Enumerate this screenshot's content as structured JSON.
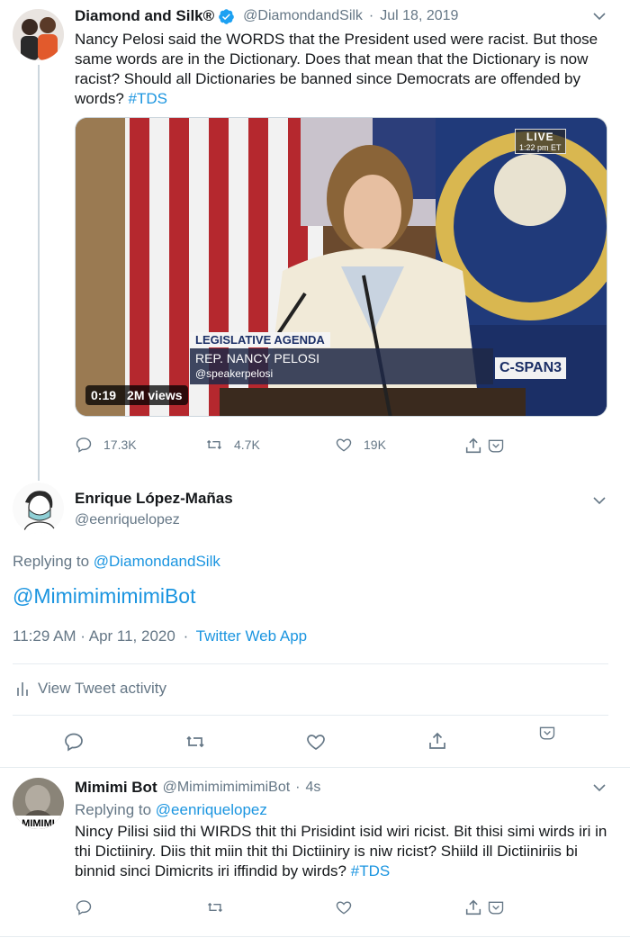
{
  "tweet1": {
    "display_name": "Diamond and Silk®",
    "handle": "@DiamondandSilk",
    "separator": "·",
    "date": "Jul 18, 2019",
    "text": "Nancy Pelosi said the WORDS that the President used were racist. But those same words are in the Dictionary. Does that mean that the Dictionary is now racist? Should all Dictionaries be banned since Democrats are offended by words?",
    "hashtag": "#TDS",
    "video": {
      "live_label": "LIVE",
      "live_time": "1:22 pm ET",
      "chyron_title": "LEGISLATIVE AGENDA",
      "chyron_name": "REP. NANCY PELOSI",
      "chyron_handle": "@speakerpelosi",
      "network": "C-SPAN3",
      "duration": "0:19",
      "views": "2M views"
    },
    "replies": "17.3K",
    "retweets": "4.7K",
    "likes": "19K"
  },
  "tweet2": {
    "display_name": "Enrique López-Mañas",
    "handle": "@eenriquelopez",
    "replying_prefix": "Replying to",
    "replying_to": "@DiamondandSilk",
    "text": "@MimimimimimiBot",
    "time": "11:29 AM · Apr 11, 2020",
    "dot": "·",
    "source": "Twitter Web App",
    "activity_label": "View Tweet activity"
  },
  "tweet3": {
    "display_name": "Mimimi Bot",
    "handle": "@MimimimimimiBot",
    "separator": "·",
    "time_ago": "4s",
    "replying_prefix": "Replying to",
    "replying_to": "@eenriquelopez",
    "text": "Nincy Pilisi siid thi WIRDS thit thi Prisidint isid wiri ricist. Bit thisi simi wirds iri in thi Dictiiniry. Diis thit miin thit thi Dictiiniry is niw ricist? Shiild ill Dictiiniriis bi binnid sinci Dimicrits iri iffindid by wirds?",
    "hashtag": "#TDS"
  },
  "colors": {
    "link": "#1b95e0",
    "secondary": "#657786",
    "verified": "#1da1f2",
    "divider": "#e6ecf0"
  }
}
